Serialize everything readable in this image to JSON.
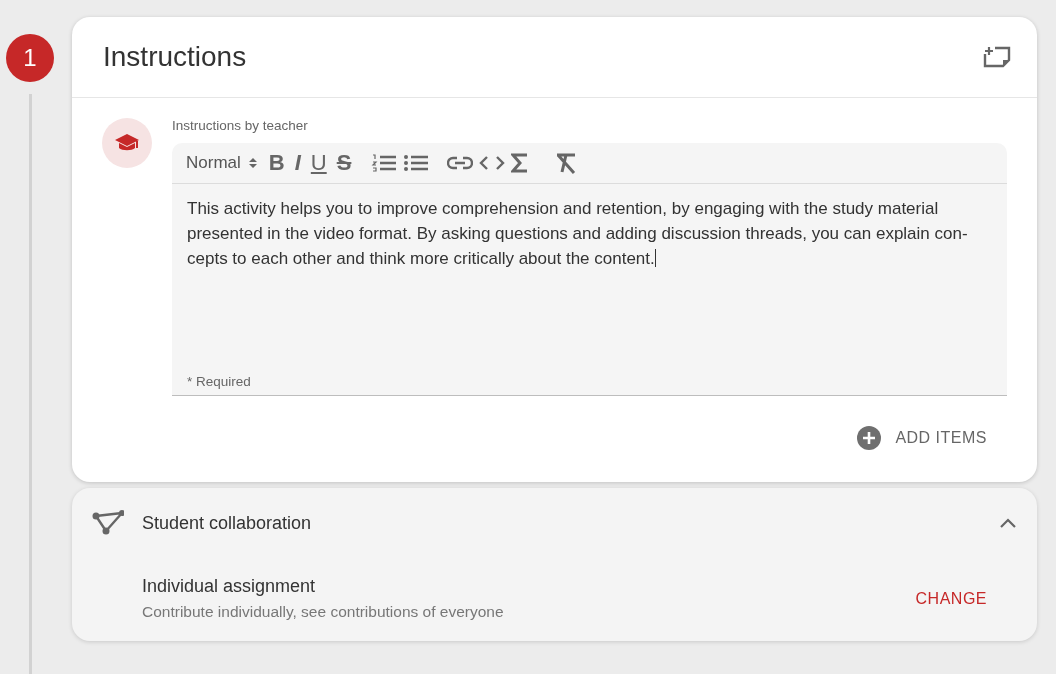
{
  "step": {
    "number": "1"
  },
  "instructions": {
    "title": "Instructions",
    "editor_label": "Instructions by teacher",
    "format_select": "Normal",
    "toolbar": [
      {
        "kind": "bold",
        "label": "B"
      },
      {
        "kind": "italic",
        "label": "I"
      },
      {
        "kind": "underline",
        "label": "U"
      },
      {
        "kind": "strike",
        "label": "S"
      },
      {
        "kind": "ordered-list"
      },
      {
        "kind": "bullet-list"
      },
      {
        "kind": "link"
      },
      {
        "kind": "code"
      },
      {
        "kind": "sigma"
      },
      {
        "kind": "clear-format"
      }
    ],
    "body": "This activity helps you to improve comprehension and retention, by engaging with the study material presented in the video format. By asking questions and adding discussion threads, you can explain con-cepts to each other and think more critically about the content.",
    "helper": "* Required",
    "add_button": "ADD ITEMS"
  },
  "collaboration": {
    "title": "Student collaboration",
    "expanded": true,
    "option_title": "Individual assignment",
    "option_description": "Contribute individually, see contributions of everyone",
    "change_button": "CHANGE"
  }
}
